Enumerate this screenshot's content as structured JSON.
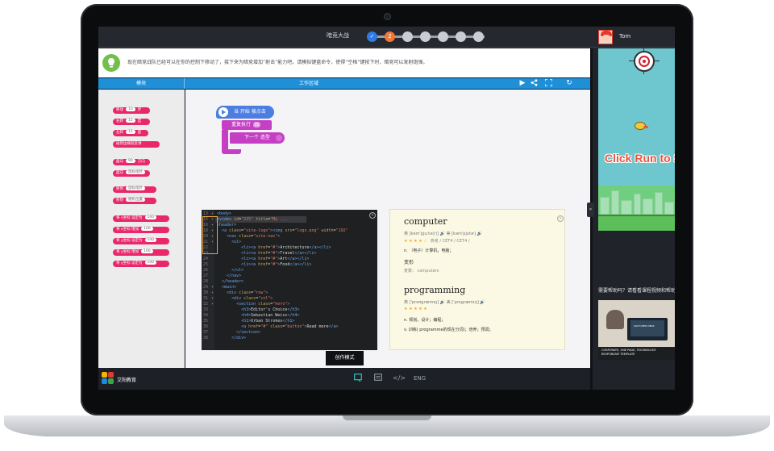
{
  "header": {
    "game_title": "暗竞大战",
    "steps": [
      "✓",
      "2",
      "",
      "",
      "",
      "",
      ""
    ],
    "user_name": "Tom"
  },
  "hint": {
    "text": "现在暗竞战队已经可以在你的控制下移动了，接下来为暗竞增加“射击”能力吧。请模拟键盘命令，使得“空格”键按下时，暗竞可以发射炮弹。"
  },
  "columns": {
    "blocks": "模块",
    "workspace": "工作区域"
  },
  "palette": {
    "blocks": [
      {
        "label": "移动",
        "slot": "10",
        "tail": "步"
      },
      {
        "label": "右转",
        "slot": "15",
        "tail": "度"
      },
      {
        "label": "左转",
        "slot": "15",
        "tail": "度"
      },
      {
        "label": "碰到边缘就反弹",
        "slot": "",
        "tail": ""
      },
      {
        "label": "面向",
        "slot": "90",
        "tail": "方向"
      },
      {
        "label": "面向",
        "slot": "鼠标指针",
        "tail": ""
      },
      {
        "label": "移到",
        "slot": "鼠标指针",
        "tail": ""
      },
      {
        "label": "移到",
        "slot": "随机位置",
        "tail": ""
      },
      {
        "label": "将 x坐标 设定为",
        "slot": "100",
        "tail": ""
      },
      {
        "label": "将 x坐标 增加",
        "slot": "100",
        "tail": ""
      },
      {
        "label": "将 y坐标 设定为",
        "slot": "100",
        "tail": ""
      },
      {
        "label": "将 y坐标 增加",
        "slot": "100",
        "tail": ""
      },
      {
        "label": "将 y坐标 设定为",
        "slot": "100",
        "tail": ""
      }
    ]
  },
  "script": {
    "hat": "当 开始 被点击",
    "repeat": "重复执行",
    "repeat_count": "25",
    "next": "下一个 造型"
  },
  "code_panel": {
    "lines": [
      {
        "n": "13",
        "f": "▾",
        "html": "<span class='tg'>&lt;body&gt;</span>"
      },
      {
        "n": "15",
        "f": "▾",
        "html": "<span class='tg'>&lt;video</span> <span class='at'>id</span>=<span class='st'>\"215\"</span> <span class='at'>title</span>=<span class='st'>\"My ...</span>"
      },
      {
        "n": "16",
        "f": "▾",
        "html": "<span class='tg'>&lt;header&gt;</span>"
      },
      {
        "n": "18",
        "f": "▾",
        "html": "&nbsp;&nbsp;<span class='tg'>&lt;a</span> <span class='at'>class</span>=<span class='st'>\"site-logo\"</span><span class='tg'>&gt;&lt;img</span> <span class='at'>src</span>=<span class='st'>\"logo.png\"</span> <span class='at'>width</span>=<span class='st'>\"192\"</span>"
      },
      {
        "n": "20",
        "f": "▾",
        "html": "&nbsp;&nbsp;&nbsp;&nbsp;<span class='tg'>&lt;nav</span> <span class='at'>class</span>=<span class='st'>\"site-nav\"</span><span class='tg'>&gt;</span>"
      },
      {
        "n": "21",
        "f": "▾",
        "html": "&nbsp;&nbsp;&nbsp;&nbsp;&nbsp;&nbsp;<span class='tg'>&lt;ul&gt;</span>"
      },
      {
        "n": "22",
        "f": "",
        "html": "&nbsp;&nbsp;&nbsp;&nbsp;&nbsp;&nbsp;&nbsp;&nbsp;&nbsp;&nbsp;<span class='tg'>&lt;li&gt;&lt;a</span> <span class='at'>href</span>=<span class='st'>\"#\"</span><span class='tg'>&gt;</span>Architecture<span class='tg'>&lt;/a&gt;&lt;/li&gt;</span>"
      },
      {
        "n": "23",
        "f": "",
        "html": "&nbsp;&nbsp;&nbsp;&nbsp;&nbsp;&nbsp;&nbsp;&nbsp;&nbsp;&nbsp;<span class='tg'>&lt;li&gt;&lt;a</span> <span class='at'>href</span>=<span class='st'>\"#\"</span><span class='tg'>&gt;</span>Travel<span class='tg'>&lt;/a&gt;&lt;/li&gt;</span>"
      },
      {
        "n": "24",
        "f": "",
        "html": "&nbsp;&nbsp;&nbsp;&nbsp;&nbsp;&nbsp;&nbsp;&nbsp;&nbsp;&nbsp;<span class='tg'>&lt;li&gt;&lt;a</span> <span class='at'>href</span>=<span class='st'>\"#\"</span><span class='tg'>&gt;</span>Art<span class='tg'>&lt;/a&gt;&lt;/li&gt;</span>"
      },
      {
        "n": "25",
        "f": "",
        "html": "&nbsp;&nbsp;&nbsp;&nbsp;&nbsp;&nbsp;&nbsp;&nbsp;&nbsp;&nbsp;<span class='tg'>&lt;li&gt;&lt;a</span> <span class='at'>href</span>=<span class='st'>\"#\"</span><span class='tg'>&gt;</span>Food<span class='tg'>&lt;/a&gt;&lt;/li&gt;</span>"
      },
      {
        "n": "26",
        "f": "",
        "html": "&nbsp;&nbsp;&nbsp;&nbsp;&nbsp;&nbsp;<span class='tg'>&lt;/ul&gt;</span>"
      },
      {
        "n": "27",
        "f": "",
        "html": "&nbsp;&nbsp;&nbsp;&nbsp;<span class='tg'>&lt;/nav&gt;</span>"
      },
      {
        "n": "28",
        "f": "",
        "html": "&nbsp;&nbsp;<span class='tg'>&lt;/header&gt;</span>"
      },
      {
        "n": "29",
        "f": "▾",
        "html": "&nbsp;&nbsp;<span class='tg'>&lt;main&gt;</span>"
      },
      {
        "n": "30",
        "f": "▾",
        "html": "&nbsp;&nbsp;&nbsp;&nbsp;<span class='tg'>&lt;div</span> <span class='at'>class</span>=<span class='st'>\"row\"</span><span class='tg'>&gt;</span>"
      },
      {
        "n": "31",
        "f": "▾",
        "html": "&nbsp;&nbsp;&nbsp;&nbsp;&nbsp;&nbsp;<span class='tg'>&lt;div</span> <span class='at'>class</span>=<span class='st'>\"col\"</span><span class='tg'>&gt;</span>"
      },
      {
        "n": "32",
        "f": "▾",
        "html": "&nbsp;&nbsp;&nbsp;&nbsp;&nbsp;&nbsp;&nbsp;&nbsp;<span class='tg'>&lt;section</span> <span class='at'>class</span>=<span class='st'>\"hero\"</span><span class='tg'>&gt;</span>"
      },
      {
        "n": "33",
        "f": "",
        "html": "&nbsp;&nbsp;&nbsp;&nbsp;&nbsp;&nbsp;&nbsp;&nbsp;&nbsp;&nbsp;<span class='tg'>&lt;h3&gt;</span>Editor's Choice<span class='tg'>&lt;/h3&gt;</span>"
      },
      {
        "n": "34",
        "f": "",
        "html": "&nbsp;&nbsp;&nbsp;&nbsp;&nbsp;&nbsp;&nbsp;&nbsp;&nbsp;&nbsp;<span class='tg'>&lt;h4&gt;</span>Sebastian Weiss<span class='tg'>&lt;/h4&gt;</span>"
      },
      {
        "n": "35",
        "f": "",
        "html": "&nbsp;&nbsp;&nbsp;&nbsp;&nbsp;&nbsp;&nbsp;&nbsp;&nbsp;&nbsp;<span class='tg'>&lt;h1&gt;</span>Urban Strokes<span class='tg'>&lt;/h1&gt;</span>"
      },
      {
        "n": "36",
        "f": "",
        "html": "&nbsp;&nbsp;&nbsp;&nbsp;&nbsp;&nbsp;&nbsp;&nbsp;&nbsp;&nbsp;<span class='tg'>&lt;a</span> <span class='at'>href</span>=<span class='st'>\"#\"</span> <span class='at'>class</span>=<span class='st'>\"button\"</span><span class='tg'>&gt;</span>Read more<span class='tg'>&lt;/a&gt;</span>"
      },
      {
        "n": "37",
        "f": "",
        "html": "&nbsp;&nbsp;&nbsp;&nbsp;&nbsp;&nbsp;&nbsp;&nbsp;<span class='tg'>&lt;/section&gt;</span>"
      },
      {
        "n": "38",
        "f": "",
        "html": "&nbsp;&nbsp;&nbsp;&nbsp;&nbsp;&nbsp;<span class='tg'>&lt;/div&gt;</span>"
      }
    ]
  },
  "dictionary": {
    "w1": "computer",
    "w1_phon": "英 [kəm'pjuːtə(r)] 🔊  美 [kəm'pjutɚ] 🔊",
    "w1_stars": "★ ★ ★ ★ ☆",
    "w1_exam": "高考 / CET4 / CET4 /",
    "w1_def": "n. （电子）计算机，电脑；",
    "w1_form": "变形",
    "w1_plural": "复数： computers",
    "w2": "programming",
    "w2_phon": "英 ['prəʊɡræmɪŋ] 🔊  美 ['proɡræmɪŋ] 🔊",
    "w2_stars": "★ ★ ★ ★ ★",
    "w2_def1": "n. 规划，设计；编程；",
    "w2_def2": "v. 训练( programme的现在分词)；培养；预调；"
  },
  "mode_button": "创作模式",
  "footer": {
    "brand": "艾阳教育",
    "lang": "ENG"
  },
  "game": {
    "banner": "Click Run to Start"
  },
  "help": {
    "title": "需要帮助吗？请看看课程视频和帮助",
    "video_title": "SUCH NEW DESK",
    "video_caption_1": "CORPORATE, ONE PAGE, TECHNOLOGY",
    "video_caption_2": "RESPONSIVE TEMPLATE"
  },
  "colors": {
    "accent": "#1f8fd8",
    "motion_block": "#e8286b",
    "event_block": "#4c7de0",
    "control_block": "#c43fc4",
    "progress_current": "#f0773a"
  }
}
